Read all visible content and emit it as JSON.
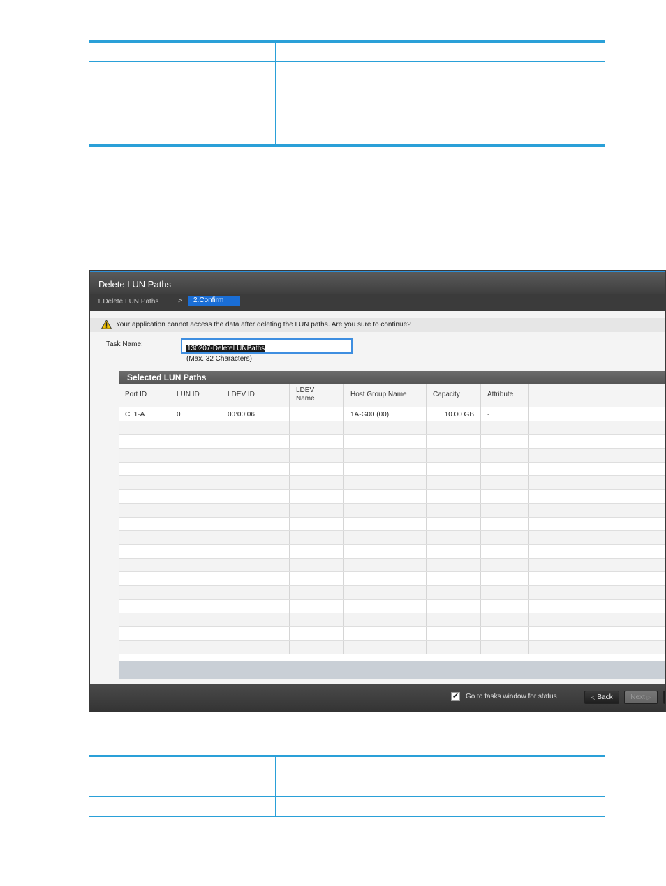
{
  "top_table": {
    "rows": [
      [
        "",
        ""
      ],
      [
        "",
        ""
      ],
      [
        "",
        ""
      ]
    ]
  },
  "dialog": {
    "title": "Delete LUN Paths",
    "steps": {
      "step1": "1.Delete LUN Paths",
      "separator": ">",
      "step2": "2.Confirm"
    },
    "warning": {
      "icon": "warning-icon",
      "text": "Your application cannot access the data after deleting the LUN paths. Are you sure to continue?"
    },
    "task_name": {
      "label": "Task Name:",
      "value": "130207-DeleteLUNPaths",
      "hint": "(Max. 32 Characters)"
    },
    "grid": {
      "title": "Selected LUN Paths",
      "columns": [
        "Port ID",
        "LUN ID",
        "LDEV ID",
        "LDEV Name",
        "Host Group Name",
        "Capacity",
        "Attribute"
      ],
      "rows": [
        {
          "port_id": "CL1-A",
          "lun_id": "0",
          "ldev_id": "00:00:06",
          "ldev_name": "",
          "host_group": "1A-G00 (00)",
          "capacity": "10.00 GB",
          "attribute": "-"
        }
      ],
      "empty_row_count": 17
    },
    "footer": {
      "checkbox_checked": true,
      "checkbox_label": "Go to tasks window for status",
      "back_label": "Back",
      "next_label": "Next"
    },
    "colors": {
      "accent": "#1a6ed6",
      "header": "#4a4a4a"
    }
  },
  "bottom_table": {
    "rows": [
      [
        "",
        ""
      ],
      [
        "",
        ""
      ],
      [
        "",
        ""
      ]
    ]
  }
}
